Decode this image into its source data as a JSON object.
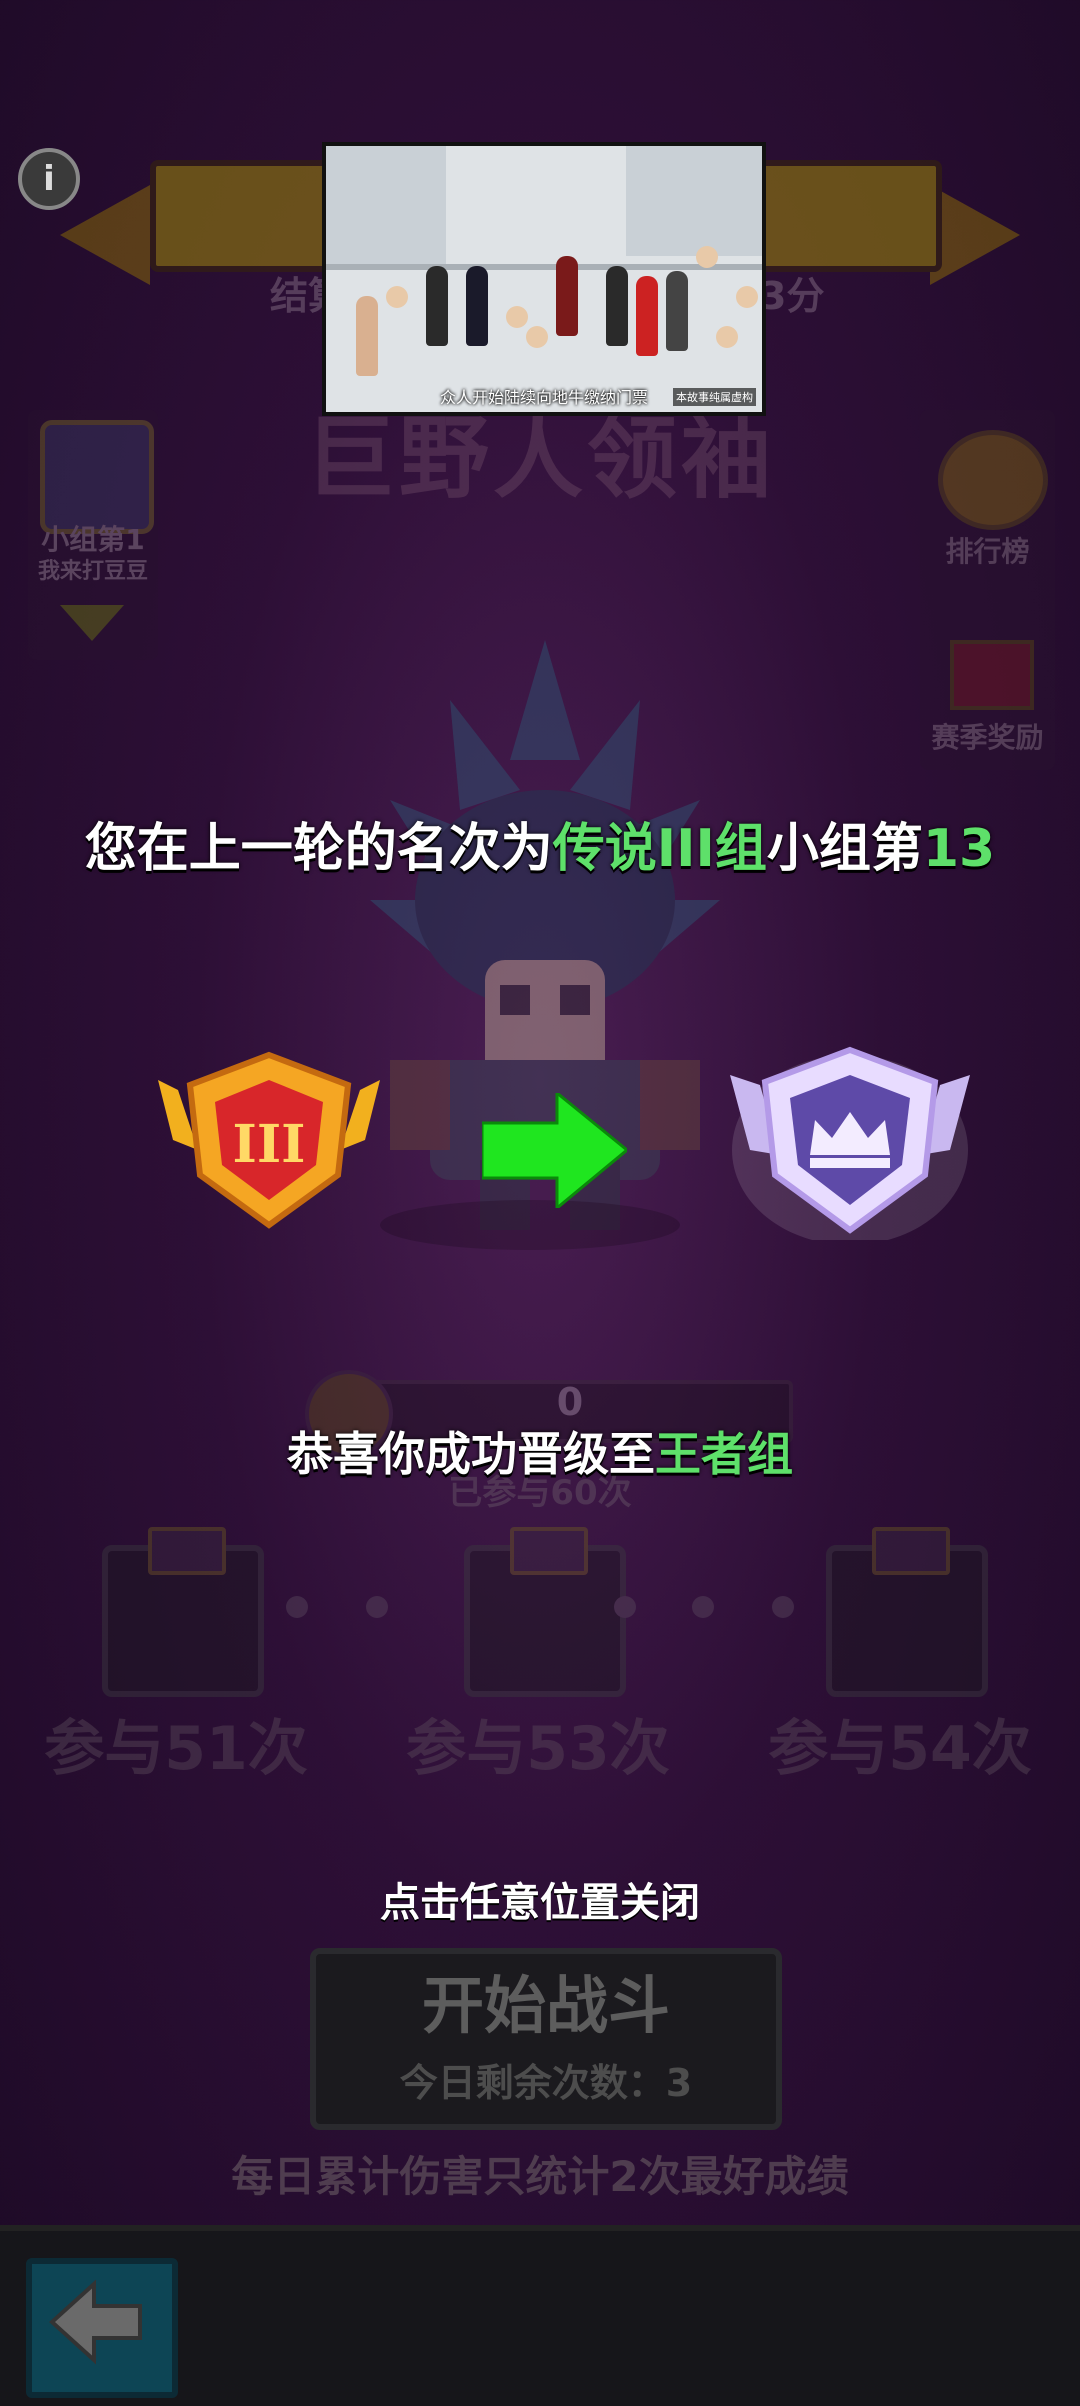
{
  "header": {
    "info_icon_glyph": "i",
    "banner_sub_left": "结算",
    "banner_sub_right": "3分"
  },
  "video": {
    "caption": "众人开始陆续向地牛缴纳门票",
    "tag": "本故事纯属虚构"
  },
  "boss": {
    "name": "巨野人领袖"
  },
  "group_panel": {
    "label": "小组第1",
    "sublabel": "我来打豆豆"
  },
  "right_panel": {
    "leaderboard_label": "排行榜",
    "reward_label": "赛季奖励"
  },
  "result": {
    "prefix": "您在上一轮的名次为",
    "group_name": "传说III组",
    "middle": "小组第",
    "rank": "13",
    "promo_prefix": "恭喜你成功晋级至",
    "promo_group": "王者组",
    "old_badge_numeral": "III"
  },
  "progress": {
    "value": "0",
    "count_label": "已参与60次"
  },
  "chests": [
    {
      "label": "参与51次"
    },
    {
      "label": "参与53次"
    },
    {
      "label": "参与54次"
    }
  ],
  "close_hint": "点击任意位置关闭",
  "start_button": {
    "label": "开始战斗",
    "remaining": "今日剩余次数：3"
  },
  "daily_note": "每日累计伤害只统计2次最好成绩",
  "colors": {
    "highlight": "#5ee06a",
    "background": "#2d0f36",
    "old_badge": "#e8a020",
    "new_badge": "#8f7adf"
  }
}
